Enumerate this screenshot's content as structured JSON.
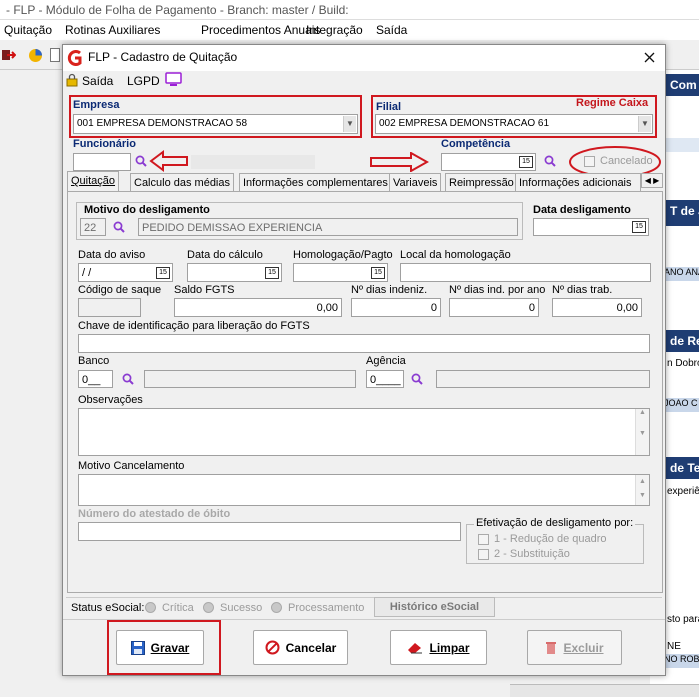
{
  "window_title": "- FLP - Módulo de Folha de Pagamento - Branch: master / Build:",
  "menu": [
    "Quitação",
    "Rotinas Auxiliares",
    "Procedimentos Anuais",
    "Integração",
    "Saída"
  ],
  "background": {
    "header1": "Com pre",
    "header2": "T de J",
    "cell1": "ANO ANA",
    "header3": "de Re",
    "text1": "n Dobro",
    "cell2": "JOAO C",
    "header4": "de Te",
    "text2": "experiê",
    "text3": "sto para",
    "text4": "NE",
    "cell3": "NO ROB"
  },
  "dialog": {
    "title": "FLP - Cadastro de Quitação",
    "top_menu": [
      "Saída",
      "LGPD"
    ],
    "empresa": {
      "label": "Empresa",
      "value": "001 EMPRESA DEMONSTRACAO 58"
    },
    "filial": {
      "label": "Filial",
      "value": "002 EMPRESA DEMONSTRACAO 61",
      "regime": "Regime Caixa"
    },
    "funcionario_label": "Funcionário",
    "competencia_label": "Competência",
    "cancelado_label": "Cancelado",
    "tabs": [
      "Quitação",
      "Calculo das médias",
      "Informações complementares",
      "Variaveis",
      "Reimpressão",
      "Informações adicionais"
    ],
    "motivo": {
      "label": "Motivo do desligamento",
      "code": "22",
      "desc": "PEDIDO DEMISSAO EXPERIENCIA"
    },
    "data_desligamento_label": "Data desligamento",
    "data_aviso": {
      "label": "Data do aviso",
      "value": " /  /"
    },
    "data_calculo_label": "Data do cálculo",
    "homologacao_label": "Homologação/Pagto",
    "local_homologacao_label": "Local da homologação",
    "codigo_saque_label": "Código de saque",
    "saldo_fgts": {
      "label": "Saldo FGTS",
      "value": "0,00"
    },
    "dias_indeniz": {
      "label": "Nº dias indeniz.",
      "value": "0"
    },
    "dias_ind_ano": {
      "label": "Nº dias ind. por ano",
      "value": "0"
    },
    "dias_trab": {
      "label": "Nº dias trab.",
      "value": "0,00"
    },
    "chave_label": "Chave de identificação para liberação do FGTS",
    "banco": {
      "label": "Banco",
      "value": "0__"
    },
    "agencia": {
      "label": "Agência",
      "value": "0____"
    },
    "observacoes_label": "Observações",
    "motivo_cancelamento_label": "Motivo Cancelamento",
    "atestado_label": "Número do atestado de óbito",
    "efetivacao": {
      "label": "Efetivação de desligamento por:",
      "opt1": "1 - Redução de quadro",
      "opt2": "2 - Substituição"
    },
    "status": {
      "label": "Status eSocial:",
      "critica": "Crítica",
      "sucesso": "Sucesso",
      "processamento": "Processamento",
      "historico": "Histórico eSocial"
    },
    "buttons": {
      "gravar": "Gravar",
      "cancelar": "Cancelar",
      "limpar": "Limpar",
      "excluir": "Excluir"
    },
    "cal_glyph": "15"
  }
}
